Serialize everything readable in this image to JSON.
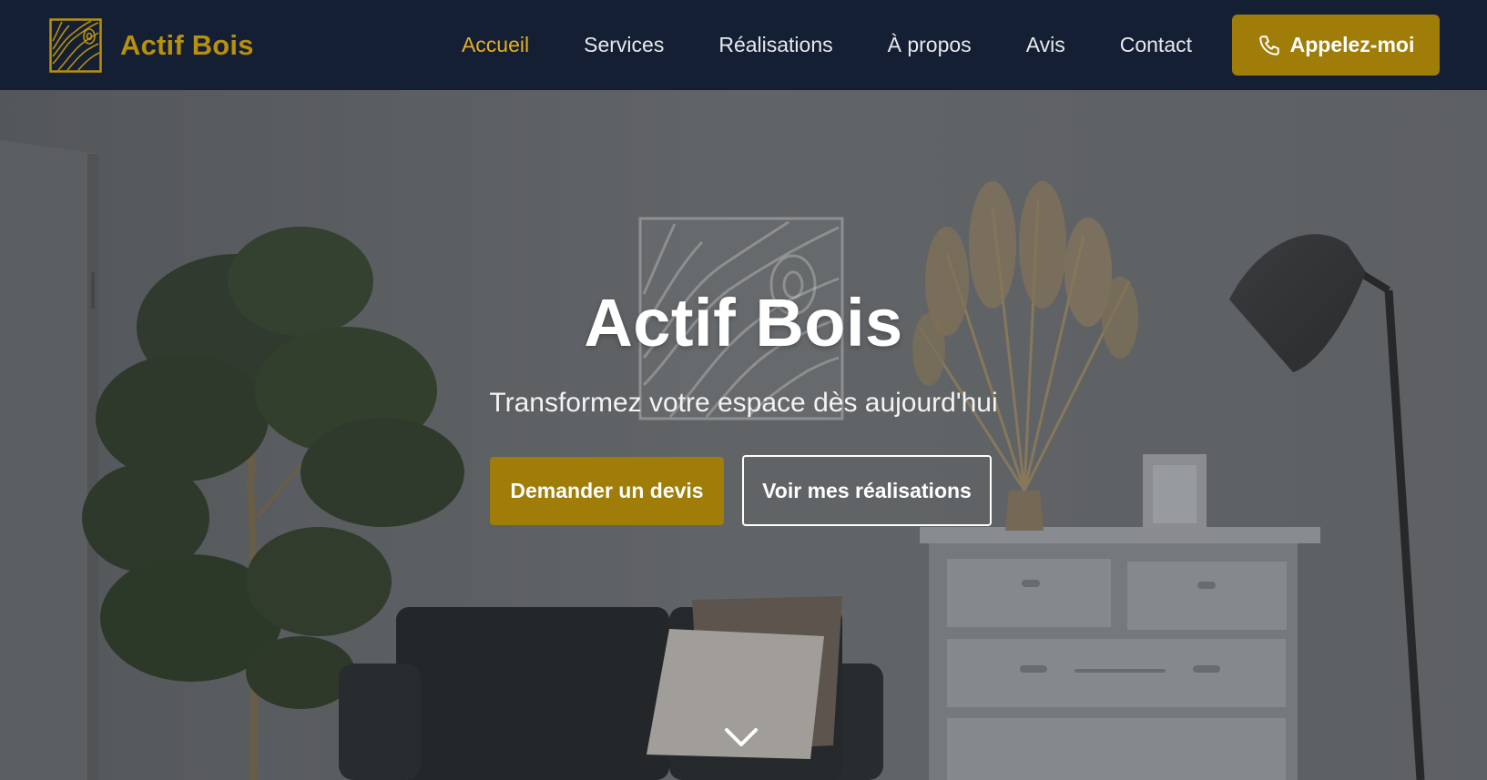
{
  "brand": {
    "name": "Actif Bois",
    "logo_icon": "wood-grain-logo-icon",
    "color": "#b8900f"
  },
  "nav": {
    "items": [
      {
        "label": "Accueil",
        "active": true
      },
      {
        "label": "Services",
        "active": false
      },
      {
        "label": "Réalisations",
        "active": false
      },
      {
        "label": "À propos",
        "active": false
      },
      {
        "label": "Avis",
        "active": false
      },
      {
        "label": "Contact",
        "active": false
      }
    ],
    "active_color": "#e4b023",
    "call_button": {
      "label": "Appelez-moi",
      "icon": "phone-icon"
    }
  },
  "hero": {
    "title": "Actif Bois",
    "subtitle": "Transformez votre espace dès aujourd'hui",
    "primary_button": "Demander un devis",
    "secondary_button": "Voir mes réalisations",
    "scroll_icon": "chevron-down-icon",
    "accent_color": "#a07c08"
  },
  "colors": {
    "header_bg": "#141f33",
    "hero_overlay": "#6e7174"
  }
}
